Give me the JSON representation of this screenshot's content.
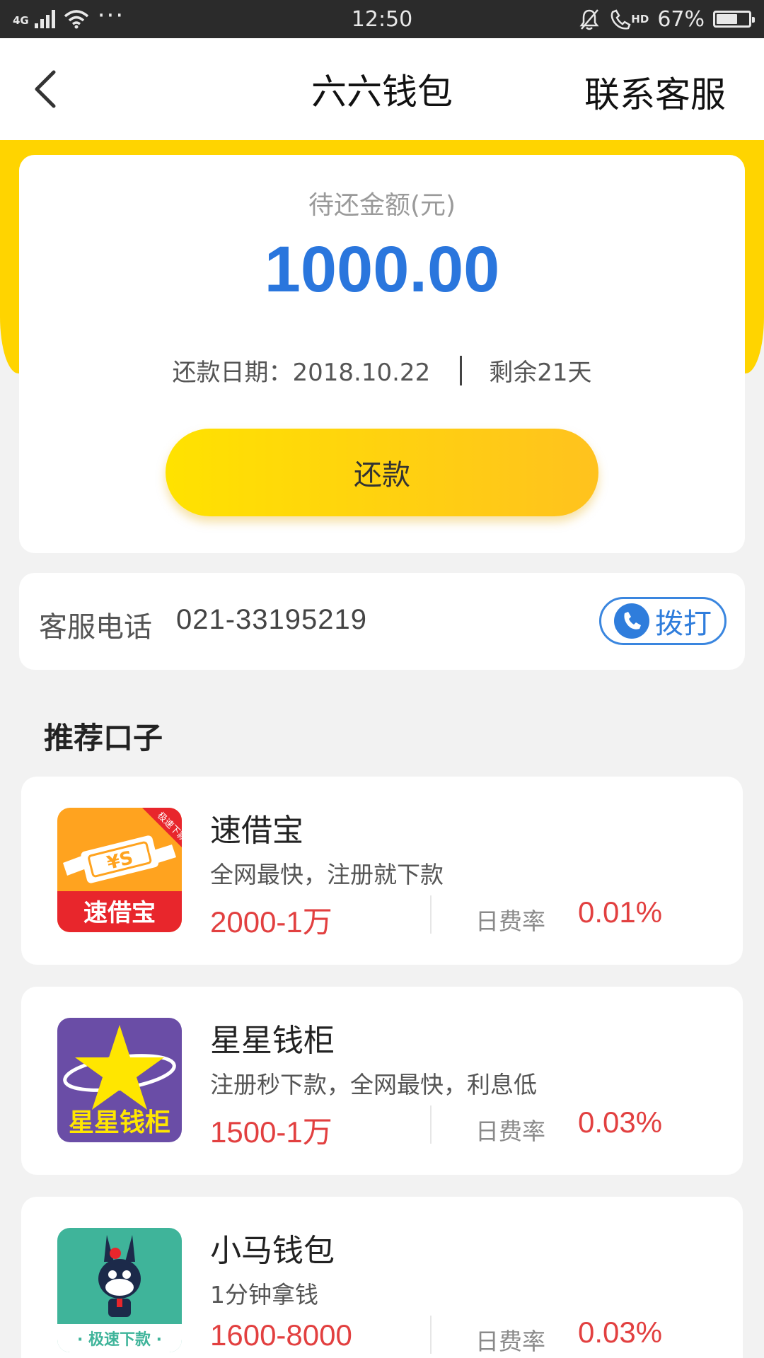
{
  "status_bar": {
    "network": "4G",
    "dots": "···",
    "time": "12:50",
    "hd": "HD",
    "battery": "67%",
    "battery_level": 0.67
  },
  "nav": {
    "title": "六六钱包",
    "action": "联系客服"
  },
  "repayment": {
    "label": "待还金额(元)",
    "amount": "1000.00",
    "date_text": "还款日期：2018.10.22",
    "remaining_text": "剩余21天",
    "button_label": "还款"
  },
  "service": {
    "label": "客服电话",
    "phone": "021-33195219",
    "call_label": "拨打"
  },
  "recommend": {
    "title": "推荐口子",
    "items": [
      {
        "name": "速借宝",
        "desc": "全网最快，注册就下款",
        "range": "2000-1万",
        "rate_label": "日费率",
        "rate": "0.01%",
        "logo_text": "速借宝",
        "logo_badge": "极速下款",
        "logo_color": "#ff9a1a"
      },
      {
        "name": "星星钱柜",
        "desc": "注册秒下款，全网最快，利息低",
        "range": "1500-1万",
        "rate_label": "日费率",
        "rate": "0.03%",
        "logo_text": "星星钱柜",
        "logo_color": "#6a4da6"
      },
      {
        "name": "小马钱包",
        "desc": "1分钟拿钱",
        "range": "1600-8000",
        "rate_label": "日费率",
        "rate": "0.03%",
        "logo_text": "· 极速下款 ·",
        "logo_color": "#3fb49a"
      }
    ]
  },
  "colors": {
    "accent_yellow": "#ffd400",
    "amount_blue": "#2a76dd",
    "loan_red": "#e24040"
  }
}
